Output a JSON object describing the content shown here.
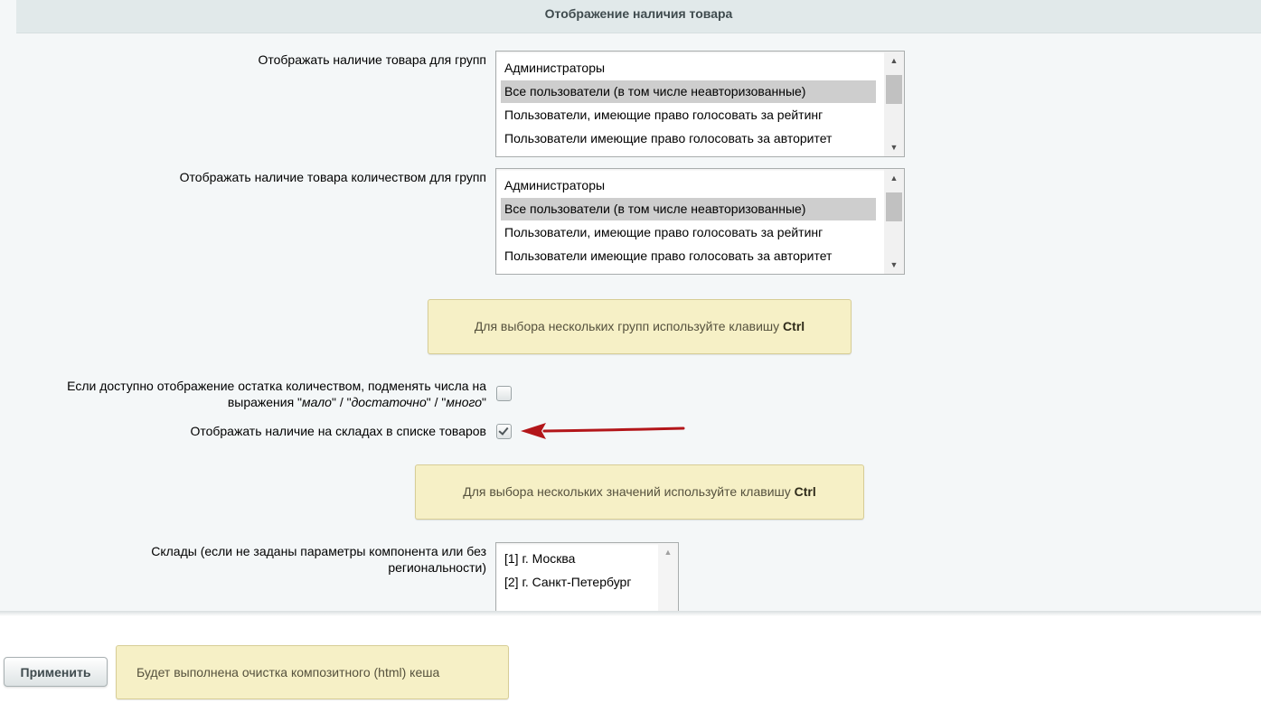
{
  "section": {
    "title": "Отображение наличия товара"
  },
  "groups_display": {
    "label": "Отображать наличие товара для групп",
    "options": [
      "Администраторы",
      "Все пользователи (в том числе неавторизованные)",
      "Пользователи, имеющие право голосовать за рейтинг",
      "Пользователи имеющие право голосовать за авторитет"
    ],
    "selected_index": 1
  },
  "groups_quantity": {
    "label": "Отображать наличие товара количеством для групп",
    "options": [
      "Администраторы",
      "Все пользователи (в том числе неавторизованные)",
      "Пользователи, имеющие право голосовать за рейтинг",
      "Пользователи имеющие право голосовать за авторитет"
    ],
    "selected_index": 1
  },
  "hint_groups": {
    "text": "Для выбора нескольких групп используйте клавишу ",
    "key": "Ctrl"
  },
  "replace_numbers": {
    "label_line1": "Если доступно отображение остатка количеством, подменять числа на",
    "label_prefix": "выражения \"",
    "word1": "мало",
    "sep1": "\" / \"",
    "word2": "достаточно",
    "sep2": "\" / \"",
    "word3": "много",
    "suffix": "\"",
    "checked": false
  },
  "show_stores": {
    "label": "Отображать наличие на складах в списке товаров",
    "checked": true
  },
  "hint_values": {
    "text": "Для выбора нескольких значений используйте клавишу ",
    "key": "Ctrl"
  },
  "stores": {
    "label_line1": "Склады (если не заданы параметры компонента или без",
    "label_line2": "региональности)",
    "options": [
      "[1] г. Москва",
      "[2] г. Санкт-Петербург"
    ]
  },
  "footer": {
    "apply_label": "Применить",
    "note": "Будет выполнена очистка композитного (html) кеша"
  },
  "colors": {
    "arrow": "#b3161a",
    "hint_bg": "#f6f0c6",
    "panel_bg": "#f4f7f8"
  },
  "icons": {
    "scroll_up": "▲",
    "scroll_down": "▼"
  }
}
